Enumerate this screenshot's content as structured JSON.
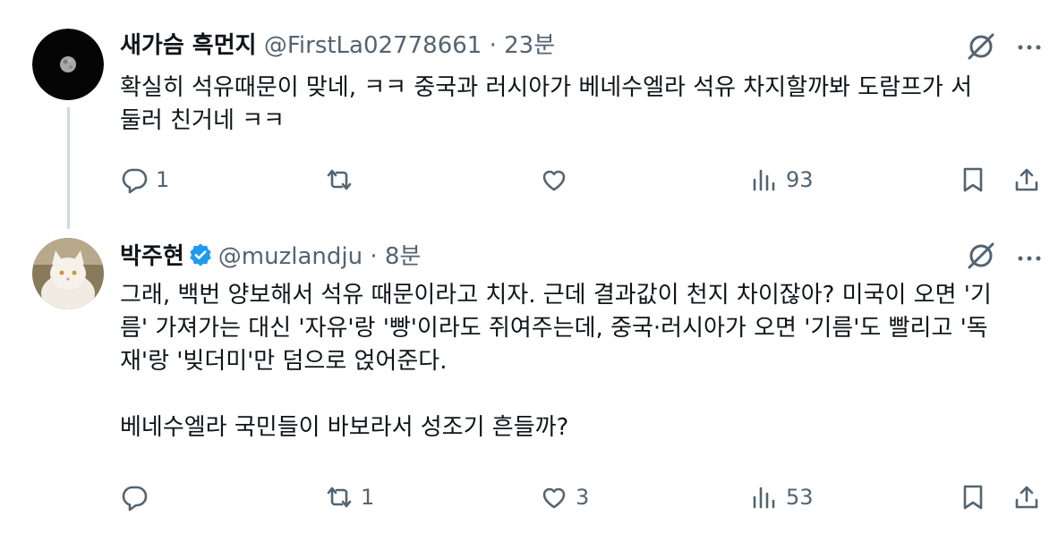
{
  "tweets": [
    {
      "name": "새가슴 흑먼지",
      "handle": "@FirstLa02778661",
      "separator": "·",
      "time": "23분",
      "text": "확실히 석유때문이 맞네, ㅋㅋ 중국과 러시아가 베네수엘라 석유 차지할까봐 도람프가 서\n둘러 친거네 ㅋㅋ",
      "verified": false,
      "actions": {
        "replies": "1",
        "reposts": "",
        "likes": "",
        "views": "93"
      }
    },
    {
      "name": "박주현",
      "handle": "@muzlandju",
      "separator": "·",
      "time": "8분",
      "text": "그래, 백번 양보해서 석유 때문이라고 치자. 근데 결과값이 천지 차이잖아? 미국이 오면 '기\n름' 가져가는 대신 '자유'랑 '빵'이라도 쥐여주는데, 중국·러시아가 오면 '기름'도 빨리고 '독\n재'랑 '빚더미'만 덤으로 얹어준다.\n\n베네수엘라 국민들이 바보라서 성조기 흔들까?",
      "verified": true,
      "actions": {
        "replies": "",
        "reposts": "1",
        "likes": "3",
        "views": "53"
      }
    }
  ],
  "icons": {
    "reply": "reply-icon",
    "repost": "repost-icon",
    "like": "like-icon",
    "views": "views-icon",
    "bookmark": "bookmark-icon",
    "share": "share-icon",
    "grok": "grok-icon",
    "more": "more-icon",
    "verified": "verified-badge-icon"
  },
  "colors": {
    "text": "#0f1419",
    "muted": "#536471",
    "verified": "#1d9bf0",
    "line": "#cfd9de"
  }
}
